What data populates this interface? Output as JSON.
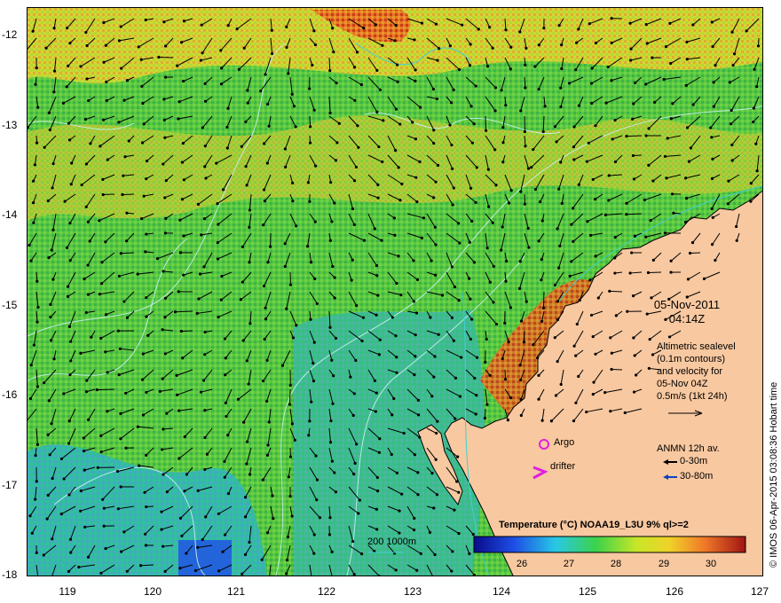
{
  "map": {
    "y_ticks": [
      "-12",
      "-13",
      "-14",
      "-15",
      "-16",
      "-17",
      "-18"
    ],
    "x_ticks": [
      "119",
      "120",
      "121",
      "122",
      "123",
      "124",
      "125",
      "126",
      "127"
    ],
    "date": "05-Nov-2011",
    "time": "04:14Z",
    "altimetry_note": [
      "Altimetric sealevel",
      "(0.1m contours)",
      "and velocity for",
      "05-Nov 04Z",
      "0.5m/s (1kt 24h)"
    ],
    "argo_label": "Argo",
    "drifter_label": "drifter",
    "anmn_title": "ANMN 12h av.",
    "anmn_shallow": "0-30m",
    "anmn_deep": "30-80m",
    "scale_bar_label": "200  1000m",
    "colorbar_title": "Temperature (°C) NOAA19_L3U 9% ql>=2",
    "colorbar_ticks": [
      "26",
      "27",
      "28",
      "29",
      "30"
    ],
    "credit": "© IMOS 06-Apr-2015 03:08:36 Hobart time",
    "colors": {
      "land": "#f8c8a0",
      "argo": "#e020e0",
      "drifter": "#e020e0",
      "contour": "#c8f0f0",
      "isobath": "#40d0d0",
      "arrow_shallow": "#000000",
      "arrow_deep": "#1040c0"
    }
  }
}
